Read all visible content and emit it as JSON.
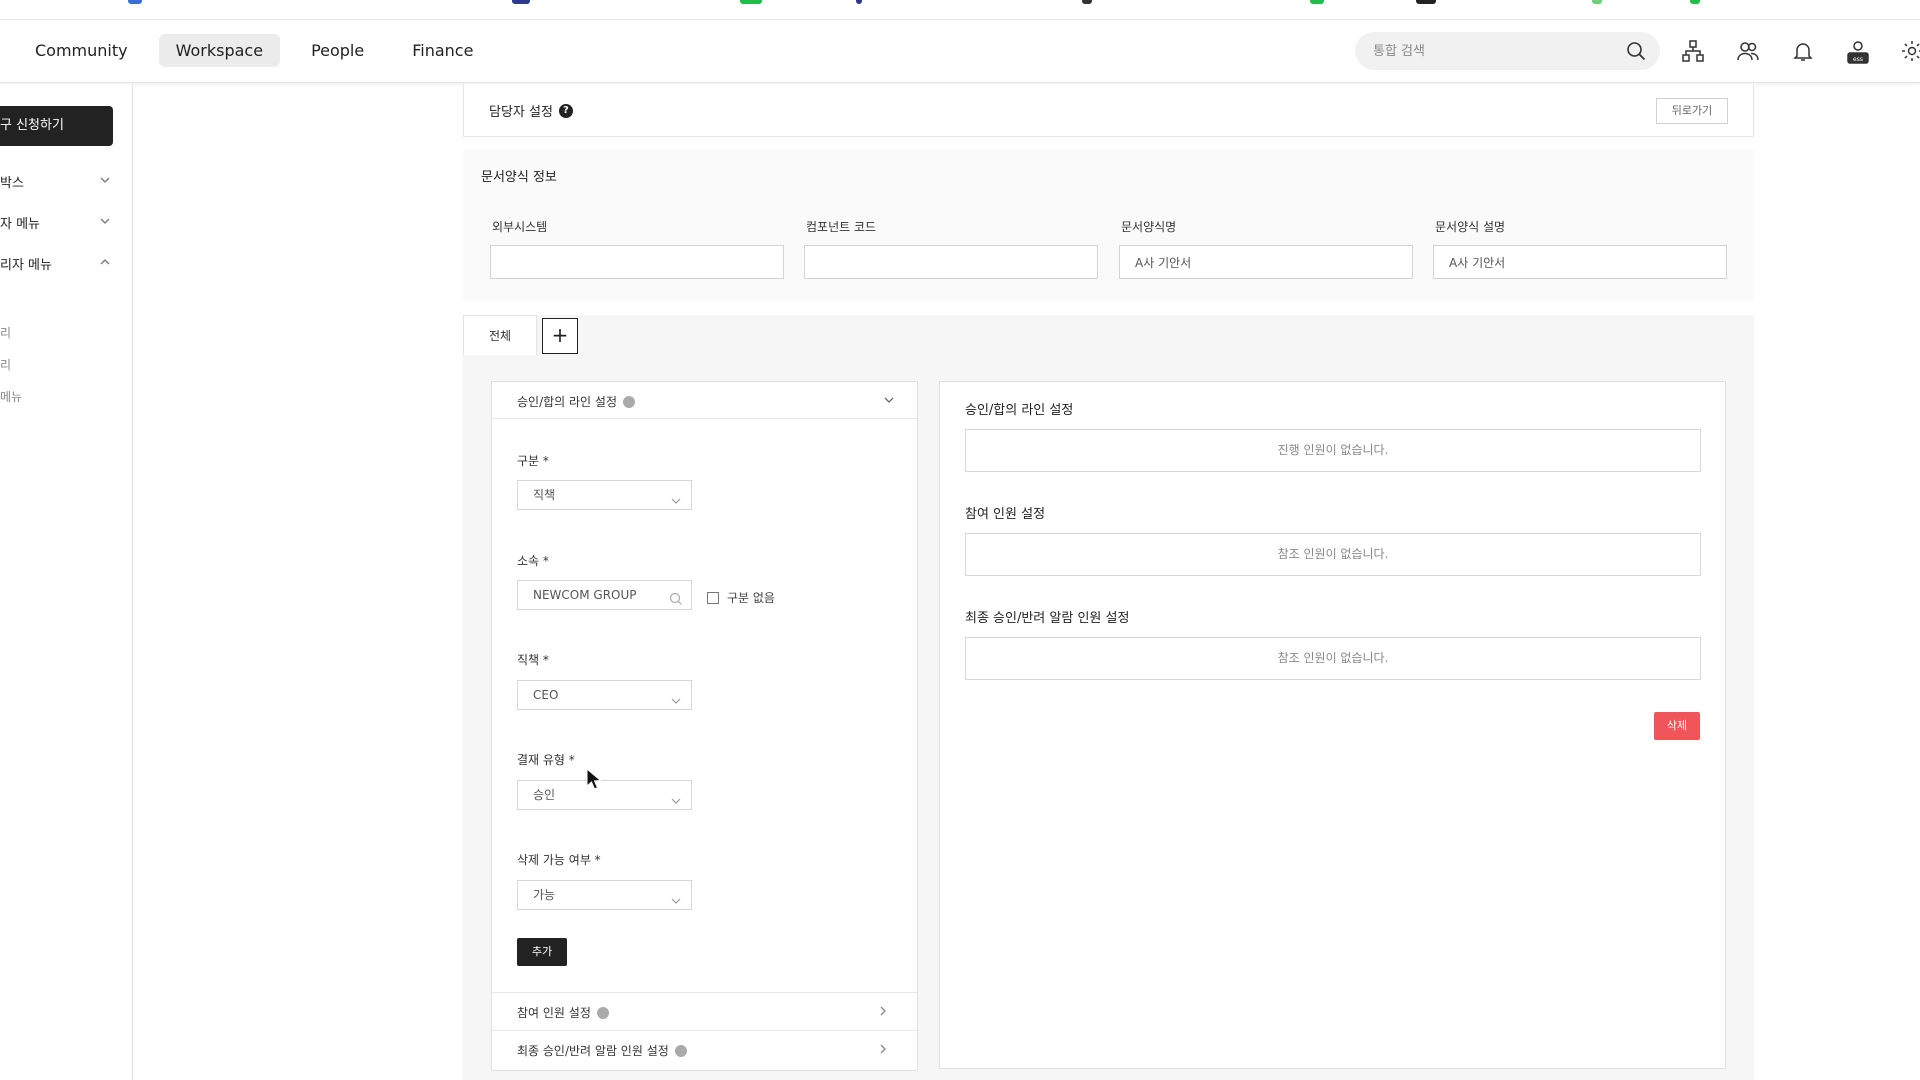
{
  "header": {
    "nav": [
      {
        "label": "Community"
      },
      {
        "label": "Workspace",
        "active": true
      },
      {
        "label": "People"
      },
      {
        "label": "Finance"
      }
    ],
    "search": {
      "placeholder": "통합 검색"
    },
    "icons": [
      "org-chart-icon",
      "people-icon",
      "bell-icon",
      "ess-icon",
      "gear-icon"
    ]
  },
  "sidebar": {
    "primary_button": "구 신청하기",
    "menus": [
      {
        "label": "박스",
        "expanded": false
      },
      {
        "label": "자 메뉴",
        "expanded": false
      },
      {
        "label": "리자 메뉴",
        "expanded": true
      }
    ],
    "sub_items": [
      "리",
      "리",
      "메뉴"
    ]
  },
  "page": {
    "title": "담당자 설정",
    "back_label": "뒤로가기"
  },
  "doc_info": {
    "section_title": "문서양식 정보",
    "fields": [
      {
        "label": "외부시스템",
        "value": ""
      },
      {
        "label": "컴포넌트 코드",
        "value": ""
      },
      {
        "label": "문서양식명",
        "value": "A사 기안서"
      },
      {
        "label": "문서양식 설명",
        "value": "A사 기안서"
      }
    ]
  },
  "tabs": {
    "items": [
      {
        "label": "전체"
      }
    ],
    "add_label": "+"
  },
  "line_form": {
    "header": "승인/합의 라인 설정",
    "category_label": "구분 *",
    "category_value": "직책",
    "affiliation_label": "소속 *",
    "affiliation_value": "NEWCOM GROUP",
    "no_category_label": "구분 없음",
    "position_label": "직책 *",
    "position_value": "CEO",
    "approval_type_label": "결재 유형 *",
    "approval_type_value": "승인",
    "deletable_label": "삭제 가능 여부 *",
    "deletable_value": "가능",
    "add_label": "추가",
    "participant_header": "참여 인원 설정",
    "final_notify_header": "최종 승인/반려 알람 인원 설정"
  },
  "summary": {
    "line_title": "승인/합의 라인 설정",
    "line_empty": "진행 인원이 없습니다.",
    "participant_title": "참여 인원 설정",
    "participant_empty": "참조 인원이 없습니다.",
    "final_title": "최종 승인/반려 알람 인원 설정",
    "final_empty": "참조 인원이 없습니다.",
    "delete_label": "삭제"
  },
  "colors": {
    "accent_dark": "#222222",
    "delete_red": "#f0555a",
    "active_tab_bg": "#ececec"
  }
}
